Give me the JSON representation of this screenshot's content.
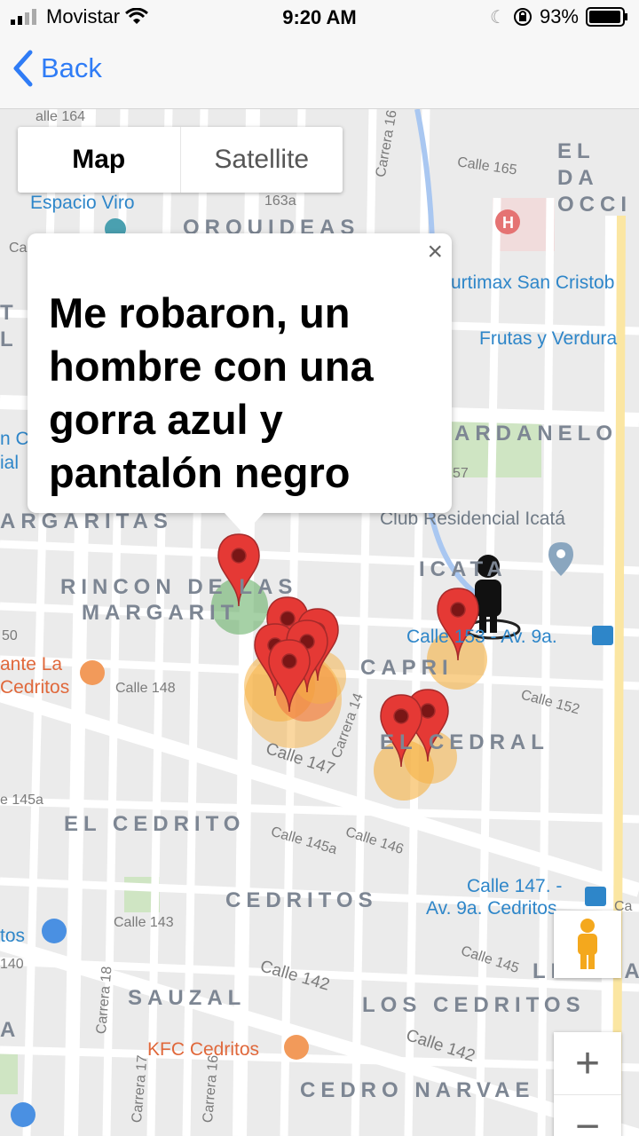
{
  "status_bar": {
    "carrier": "Movistar",
    "time": "9:20 AM",
    "battery": "93%"
  },
  "nav": {
    "back_label": "Back"
  },
  "map_type": {
    "map": "Map",
    "satellite": "Satellite",
    "selected": "Map"
  },
  "info_window": {
    "text": "Me robaron, un hombre con una gorra azul y pantalón negro"
  },
  "controls": {
    "zoom_in": "+",
    "zoom_out": "−"
  },
  "neighborhoods": [
    "EL DA OCCI",
    "ORQUIDEAS",
    "T L",
    "ARDANELO",
    "ARGARITAS",
    "RINCON DE LAS",
    "MARGARIT",
    "ICATA",
    "CAPRI",
    "EL CEDRAL",
    "EL CEDRITO",
    "CEDRITOS",
    "SAUZAL",
    "LOS CEDRITOS",
    "CEDRO NARVAE",
    "LISBOA",
    "A"
  ],
  "streets": [
    "alle 164",
    "Carrera 16",
    "Calle 165",
    "163a",
    "Ca",
    "57",
    "50",
    "Calle 148",
    "Calle 152",
    "Carrera 14",
    "Calle 147",
    "e 145a",
    "Calle 145a",
    "Calle 146",
    "Calle 143",
    "140",
    "Calle 142",
    "Calle 145",
    "Carrera 18",
    "Carrera 17",
    "Carrera 16",
    "Calle 142",
    "Ca"
  ],
  "pois": [
    {
      "text": "Espacio Viro",
      "color": "blue"
    },
    {
      "text": "urtimax San Cristob",
      "color": "blue"
    },
    {
      "text": "Frutas y Verdura",
      "color": "blue"
    },
    {
      "text": "n C",
      "color": "blue"
    },
    {
      "text": "ial",
      "color": "blue"
    },
    {
      "text": "Club Residencial Icatá",
      "color": "grey"
    },
    {
      "text": "Calle 153 - Av. 9a.",
      "color": "blue"
    },
    {
      "text": "ante La",
      "color": "orange"
    },
    {
      "text": "Cedritos",
      "color": "orange"
    },
    {
      "text": "Calle 147. -",
      "color": "blue"
    },
    {
      "text": "Av. 9a. Cedritos",
      "color": "blue"
    },
    {
      "text": "tos",
      "color": "blue"
    },
    {
      "text": "KFC Cedritos",
      "color": "orange"
    }
  ],
  "colors": {
    "accent": "#2f7cf6",
    "marker": "#e53935",
    "heat_orange": "#f5b041",
    "heat_green": "#5cab5c"
  }
}
